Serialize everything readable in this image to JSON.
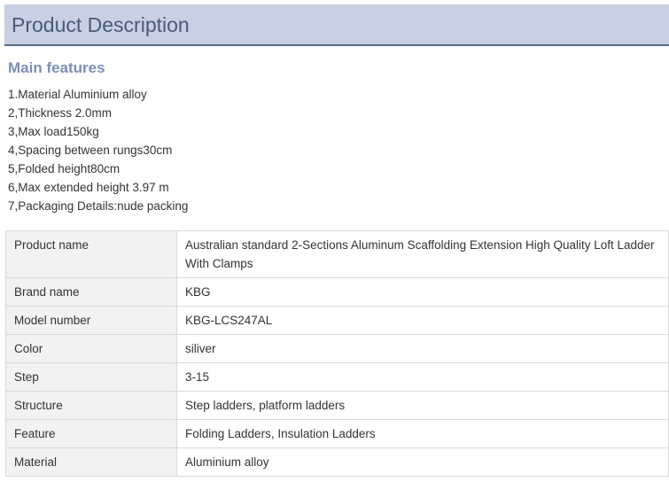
{
  "header": {
    "title": "Product Description"
  },
  "main_features": {
    "heading": "Main features",
    "items": [
      "1.Material Aluminium alloy",
      "2,Thickness 2.0mm",
      "3,Max load150kg",
      "4,Spacing between rungs30cm",
      "5,Folded height80cm",
      "6,Max extended height 3.97 m",
      "7,Packaging Details:nude packing"
    ]
  },
  "specs": {
    "rows": [
      {
        "key": "Product name",
        "value": "Australian standard 2-Sections Aluminum Scaffolding Extension High Quality Loft Ladder With Clamps"
      },
      {
        "key": "Brand name",
        "value": "KBG"
      },
      {
        "key": "Model number",
        "value": "KBG-LCS247AL"
      },
      {
        "key": "Color",
        "value": "siliver"
      },
      {
        "key": "Step",
        "value": "3-15"
      },
      {
        "key": "Structure",
        "value": "Step ladders, platform ladders"
      },
      {
        "key": "Feature",
        "value": "Folding Ladders, Insulation Ladders"
      },
      {
        "key": "Material",
        "value": "Aluminium alloy"
      }
    ]
  },
  "colors": {
    "header_bg": "#c9d0e4",
    "header_border": "#5b6a86",
    "header_text": "#4a5a7a",
    "section_heading": "#7a8fb6",
    "table_key_bg": "#f2f2f2",
    "table_border": "#d9d9d9"
  }
}
